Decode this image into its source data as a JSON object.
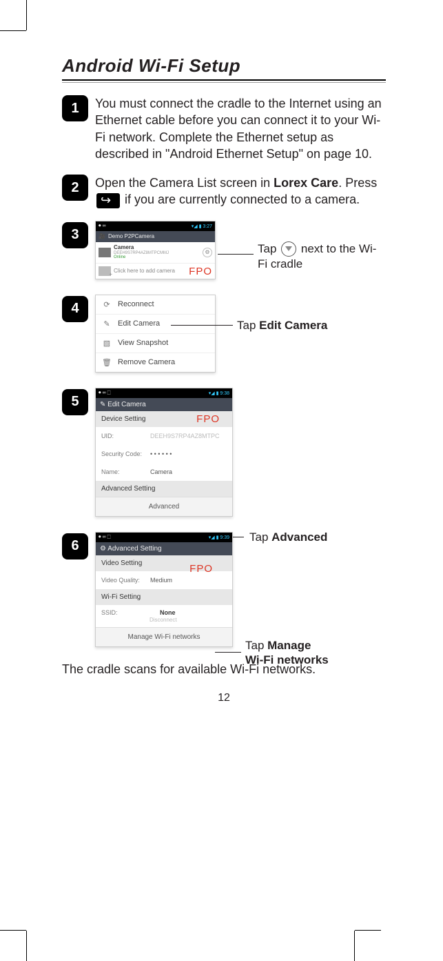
{
  "title": "Android Wi-Fi Setup",
  "page_number": "12",
  "steps": {
    "s1": {
      "num": "1",
      "text": "You must connect the cradle to the Internet using an Ethernet cable before you can connect it to your Wi-Fi network. Complete the Ethernet setup as described in \"Android Ethernet Setup\" on page 10."
    },
    "s2": {
      "num": "2",
      "pre": "Open the Camera List screen in ",
      "bold1": "Lorex Care",
      "mid": ". Press ",
      "post": " if you are currently connected to a camera."
    },
    "s3": {
      "num": "3"
    },
    "s4": {
      "num": "4"
    },
    "s5": {
      "num": "5"
    },
    "s6": {
      "num": "6"
    }
  },
  "callouts": {
    "c3a": "Tap ",
    "c3b": " next to the Wi-Fi cradle",
    "c4_pre": "Tap ",
    "c4_bold": "Edit Camera",
    "c5_pre": "Tap ",
    "c5_bold": "Advanced",
    "c6_pre": "Tap ",
    "c6_bold1": "Manage",
    "c6_bold2": "Wi-Fi networks"
  },
  "fpo": "FPO",
  "shot3": {
    "time": "3:27",
    "header": "Demo P2PCamera",
    "cam_name": "Camera",
    "cam_uid": "DEEH9S7RP4AZ8MTPCMMJ",
    "cam_status": "Online",
    "add_text": "Click here to add camera"
  },
  "shot4": {
    "m1": "Reconnect",
    "m2": "Edit Camera",
    "m3": "View Snapshot",
    "m4": "Remove Camera"
  },
  "shot5": {
    "time": "9:38",
    "title": "Edit Camera",
    "sect1": "Device Setting",
    "uid_lbl": "UID:",
    "uid_val": "DEEH9S7RP4AZ8MTPC",
    "sec_lbl": "Security Code:",
    "sec_val": "• • • • • •",
    "name_lbl": "Name:",
    "name_val": "Camera",
    "sect2": "Advanced Setting",
    "adv_btn": "Advanced"
  },
  "shot6": {
    "time": "9:39",
    "title": "Advanced Setting",
    "sect1": "Video Setting",
    "vq_lbl": "Video Quality:",
    "vq_val": "Medium",
    "sect2": "Wi-Fi Setting",
    "ssid_lbl": "SSID:",
    "ssid_val": "None",
    "ssid_sub": "Disconnect",
    "manage_btn": "Manage Wi-Fi networks"
  },
  "bottom_text": "The cradle scans for available Wi-Fi networks."
}
